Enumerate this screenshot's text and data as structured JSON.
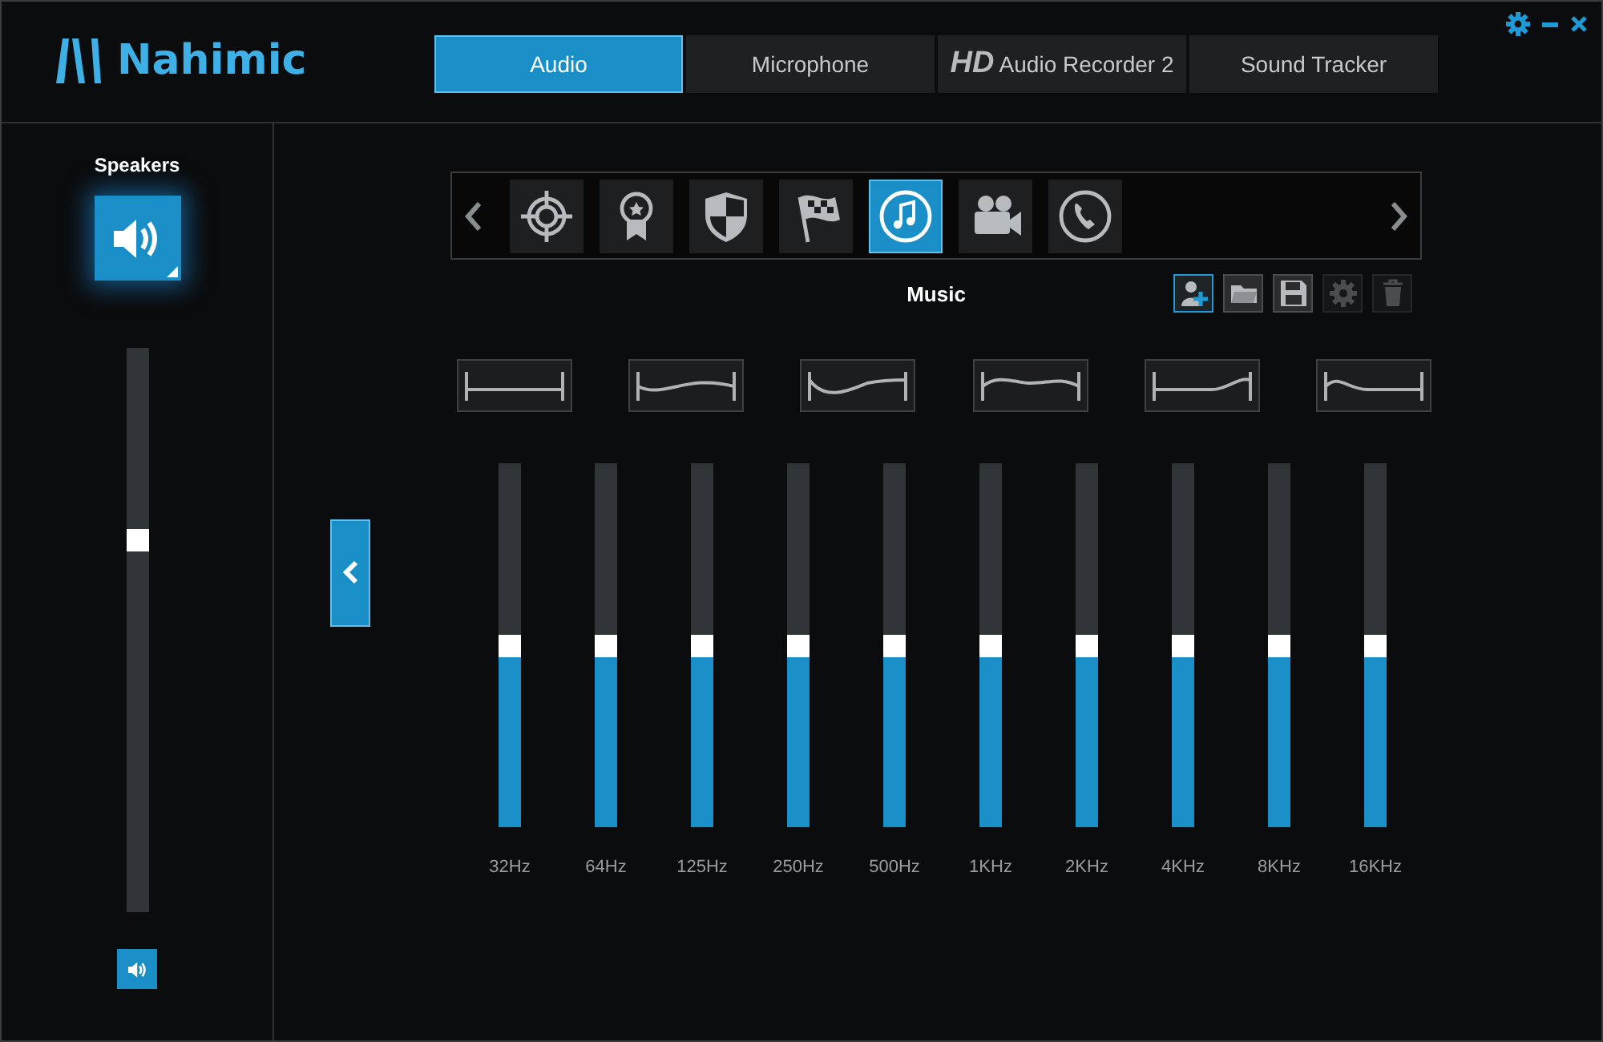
{
  "app": {
    "logo": "Nahimic"
  },
  "tabs": [
    {
      "label": "Audio",
      "selected": true
    },
    {
      "label": "Microphone",
      "selected": false
    },
    {
      "label": "**HD** Audio Recorder 2",
      "selected": false
    },
    {
      "label": "Sound Tracker",
      "selected": false
    }
  ],
  "device": {
    "title": "Speakers",
    "volume": {
      "level": 0.66
    }
  },
  "profiles": {
    "items": [
      {
        "kind": "crosshair",
        "selected": false
      },
      {
        "kind": "medal",
        "selected": false
      },
      {
        "kind": "shield",
        "selected": false
      },
      {
        "kind": "flag",
        "selected": false
      },
      {
        "kind": "music",
        "selected": true
      },
      {
        "kind": "camera",
        "selected": false
      },
      {
        "kind": "phone",
        "selected": false
      }
    ],
    "current": "Music"
  },
  "toolbar": [
    {
      "kind": "add-user",
      "active": true,
      "disabled": false
    },
    {
      "kind": "folder",
      "active": false,
      "disabled": false
    },
    {
      "kind": "save",
      "active": false,
      "disabled": false
    },
    {
      "kind": "gear",
      "active": false,
      "disabled": true
    },
    {
      "kind": "trash",
      "active": false,
      "disabled": true
    }
  ],
  "equalizer": [
    {
      "label": "32Hz",
      "level": 0.5
    },
    {
      "label": "64Hz",
      "level": 0.5
    },
    {
      "label": "125Hz",
      "level": 0.5
    },
    {
      "label": "250Hz",
      "level": 0.5
    },
    {
      "label": "500Hz",
      "level": 0.5
    },
    {
      "label": "1KHz",
      "level": 0.5
    },
    {
      "label": "2KHz",
      "level": 0.5
    },
    {
      "label": "4KHz",
      "level": 0.5
    },
    {
      "label": "8KHz",
      "level": 0.5
    },
    {
      "label": "16KHz",
      "level": 0.5
    }
  ]
}
